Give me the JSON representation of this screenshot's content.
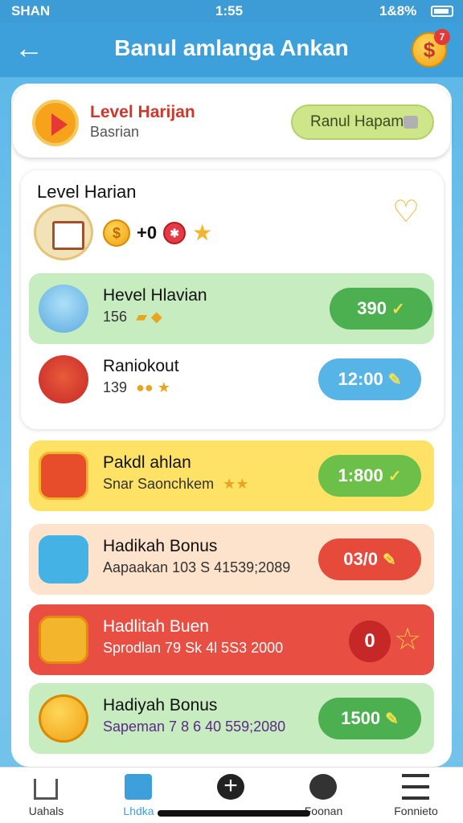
{
  "status_bar": {
    "signal_text": "SHAN",
    "time": "1:55",
    "battery_pct": "1&8%"
  },
  "header": {
    "title": "Banul amlanga Ankan",
    "coin_badge": "7"
  },
  "top_card": {
    "title": "Level Harijan",
    "subtitle": "Basrian",
    "action_label": "Ranul Hapam"
  },
  "daily": {
    "section_title": "Level Harian",
    "row_text": "+0"
  },
  "rewards": [
    {
      "title": "Hevel Hlavian",
      "desc": "156",
      "claim": "390"
    },
    {
      "title": "Raniokout",
      "desc": "139",
      "claim": "12:00"
    },
    {
      "title": "Pakdl ahlan",
      "desc": "Snar Saonchkem",
      "claim": "1:800"
    },
    {
      "title": "Hadikah Bonus",
      "desc": "Aapaakan 103 S 41539;2089",
      "claim": "03/0"
    },
    {
      "title": "Hadlitah Buen",
      "desc": "Sprodlan 79 Sk 4l 5S3 2000",
      "claim": "0"
    },
    {
      "title": "Hadiyah Bonus",
      "desc": "Sapeman 7 8 6 40 559;2080",
      "claim": "1500"
    }
  ],
  "nav": [
    {
      "label": "Uahals",
      "icon": "home-icon"
    },
    {
      "label": "Lhdka",
      "icon": "home-active-icon"
    },
    {
      "label": "",
      "icon": "plus-circle-icon"
    },
    {
      "label": "Foonan",
      "icon": "image-icon"
    },
    {
      "label": "Fonnieto",
      "icon": "menu-icon"
    }
  ]
}
